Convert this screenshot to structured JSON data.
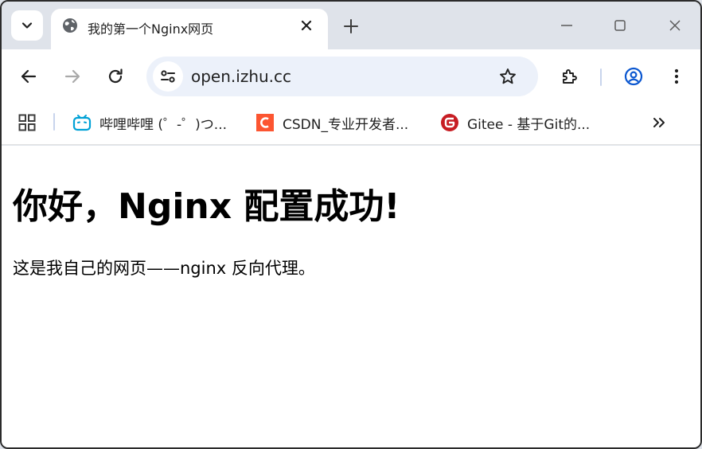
{
  "tab": {
    "title": "我的第一个Nginx网页"
  },
  "address_bar": {
    "url": "open.izhu.cc"
  },
  "bookmarks": [
    {
      "label": "哔哩哔哩 (゜-゜)つ...",
      "icon": "bilibili-icon"
    },
    {
      "label": "CSDN_专业开发者...",
      "icon": "csdn-icon"
    },
    {
      "label": "Gitee - 基于Git的...",
      "icon": "gitee-icon"
    }
  ],
  "page": {
    "heading": "你好，Nginx 配置成功!",
    "paragraph": "这是我自己的网页——nginx 反向代理。"
  },
  "colors": {
    "chrome_bg": "#dfe3ea",
    "omnibox_bg": "#ecf1fa",
    "accent_blue": "#0b57d0",
    "bilibili_blue": "#00a1d6",
    "csdn_orange": "#fc5531",
    "gitee_red": "#c71d23"
  }
}
